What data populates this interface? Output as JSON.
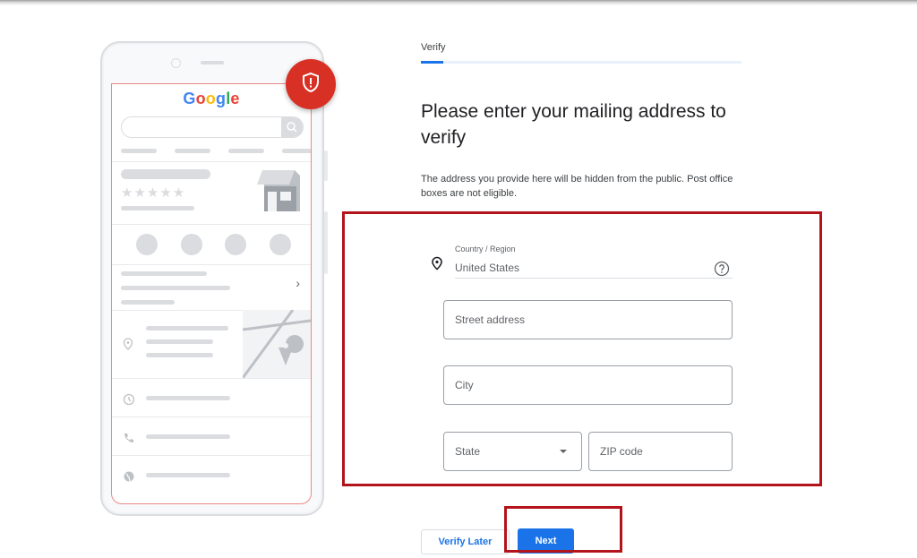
{
  "illustration": {
    "logo_letters": [
      {
        "char": "G",
        "color": "#4285f4"
      },
      {
        "char": "o",
        "color": "#ea4335"
      },
      {
        "char": "o",
        "color": "#fbbc05"
      },
      {
        "char": "g",
        "color": "#4285f4"
      },
      {
        "char": "l",
        "color": "#34a853"
      },
      {
        "char": "e",
        "color": "#ea4335"
      }
    ],
    "stars": "★★★★★",
    "chevron": "›",
    "action_icons": [
      "phone-icon",
      "directions-icon",
      "bookmark-icon",
      "website-icon"
    ],
    "detail_icons": [
      "location-icon",
      "clock-icon",
      "phone-icon",
      "globe-icon"
    ],
    "badge_icon": "shield-alert-icon"
  },
  "step": {
    "label": "Verify",
    "progress_fraction": 0.07
  },
  "heading": "Please enter your mailing address to verify",
  "description": "The address you provide here will be hidden from the public. Post office boxes are not eligible.",
  "form": {
    "country": {
      "label": "Country / Region",
      "value": "United States"
    },
    "street": {
      "placeholder": "Street address",
      "value": ""
    },
    "city": {
      "placeholder": "City",
      "value": ""
    },
    "state": {
      "placeholder": "State",
      "value": ""
    },
    "zip": {
      "placeholder": "ZIP code",
      "value": ""
    }
  },
  "buttons": {
    "verify_later": "Verify Later",
    "next": "Next"
  },
  "colors": {
    "accent": "#1a73e8",
    "highlight": "#b3141b",
    "badge": "#d93025"
  }
}
